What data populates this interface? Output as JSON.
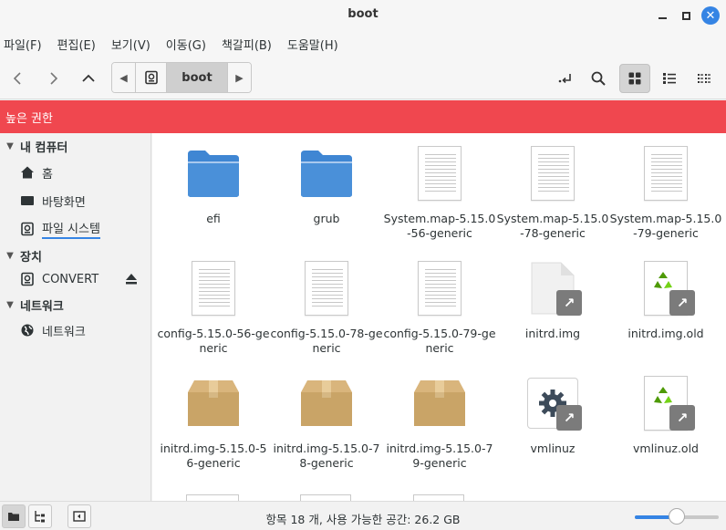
{
  "window": {
    "title": "boot"
  },
  "menubar": {
    "items": [
      "파일(F)",
      "편집(E)",
      "보기(V)",
      "이동(G)",
      "책갈피(B)",
      "도움말(H)"
    ]
  },
  "toolbar": {
    "path_current": "boot",
    "icons": [
      "back-arrow-icon",
      "forward-arrow-icon",
      "up-arrow-icon",
      "drive-icon",
      "location-toggle-icon",
      "search-icon",
      "grid-view-icon",
      "list-view-icon",
      "compact-view-icon"
    ]
  },
  "banner": {
    "text": "높은 권한",
    "color": "#f0474f"
  },
  "sidebar": {
    "sections": [
      {
        "label": "내 컴퓨터",
        "items": [
          {
            "label": "홈",
            "icon": "home-icon"
          },
          {
            "label": "바탕화면",
            "icon": "desktop-icon"
          },
          {
            "label": "파일 시스템",
            "icon": "drive-icon",
            "active": true
          }
        ]
      },
      {
        "label": "장치",
        "items": [
          {
            "label": "CONVERT",
            "icon": "drive-icon",
            "eject": true
          }
        ]
      },
      {
        "label": "네트워크",
        "items": [
          {
            "label": "네트워크",
            "icon": "network-icon"
          }
        ]
      }
    ]
  },
  "files": [
    {
      "name": "efi",
      "type": "folder"
    },
    {
      "name": "grub",
      "type": "folder"
    },
    {
      "name": "System.map-5.15.0-56-generic",
      "type": "text"
    },
    {
      "name": "System.map-5.15.0-78-generic",
      "type": "text"
    },
    {
      "name": "System.map-5.15.0-79-generic",
      "type": "text"
    },
    {
      "name": "config-5.15.0-56-generic",
      "type": "text"
    },
    {
      "name": "config-5.15.0-78-generic",
      "type": "text"
    },
    {
      "name": "config-5.15.0-79-generic",
      "type": "text"
    },
    {
      "name": "initrd.img",
      "type": "symlink-blank"
    },
    {
      "name": "initrd.img.old",
      "type": "symlink-recycle"
    },
    {
      "name": "initrd.img-5.15.0-56-generic",
      "type": "package"
    },
    {
      "name": "initrd.img-5.15.0-78-generic",
      "type": "package"
    },
    {
      "name": "initrd.img-5.15.0-79-generic",
      "type": "package"
    },
    {
      "name": "vmlinuz",
      "type": "symlink-gear"
    },
    {
      "name": "vmlinuz.old",
      "type": "symlink-recycle"
    }
  ],
  "status": {
    "text": "항목 18 개, 사용 가능한 공간: 26.2 GB",
    "zoom_fraction": 0.5
  },
  "colors": {
    "accent": "#3584e4",
    "folder": "#4a90d9",
    "package": "#c9a467",
    "recycle": "#4e9a06"
  }
}
